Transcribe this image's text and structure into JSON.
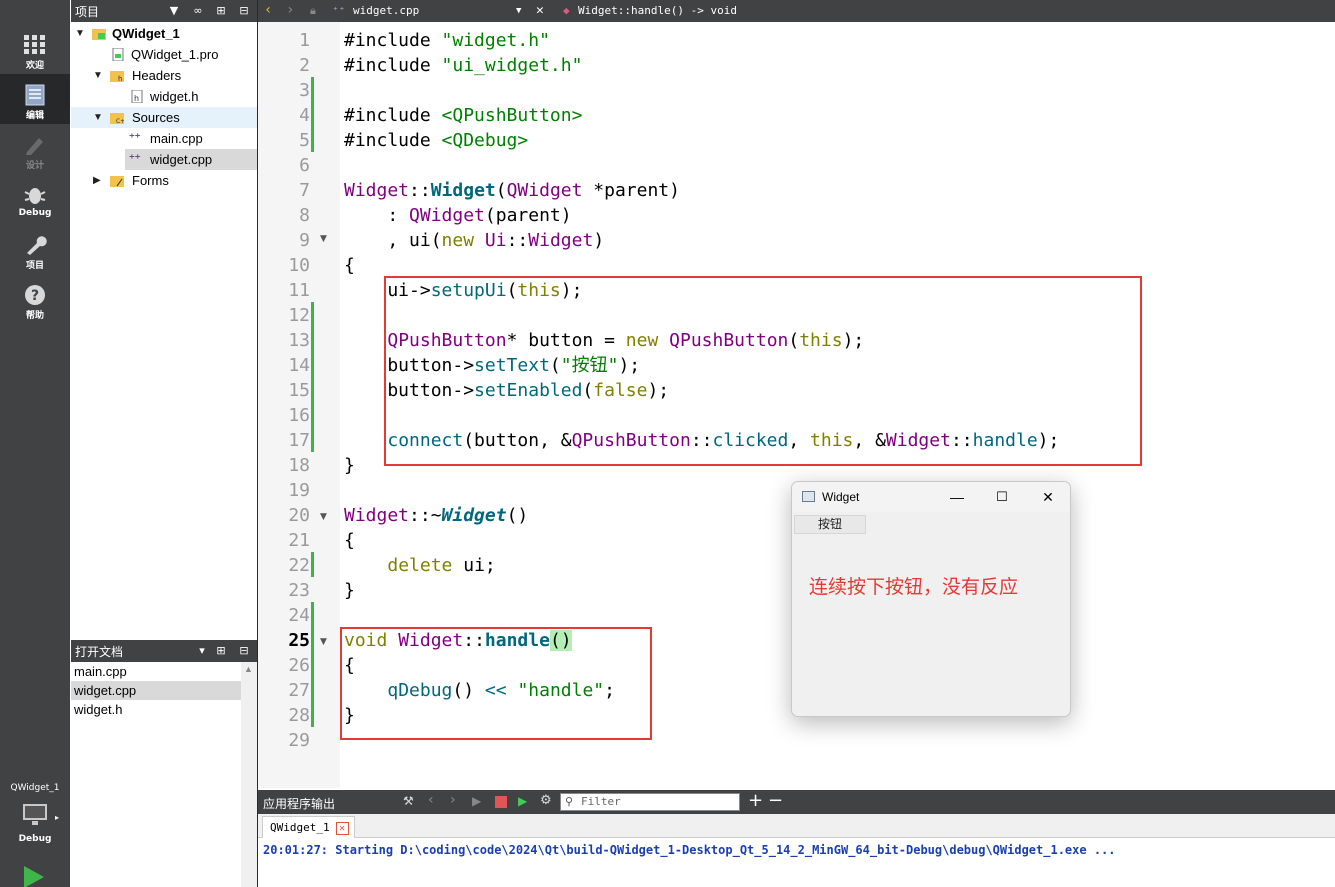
{
  "mode_bar": {
    "items": [
      {
        "label": "欢迎",
        "icon": "grid-icon"
      },
      {
        "label": "编辑",
        "icon": "edit-document-icon"
      },
      {
        "label": "设计",
        "icon": "pencil-icon"
      },
      {
        "label": "Debug",
        "icon": "bug-icon"
      },
      {
        "label": "项目",
        "icon": "wrench-icon"
      },
      {
        "label": "帮助",
        "icon": "help-icon"
      }
    ],
    "target_project": "QWidget_1",
    "target_mode": "Debug"
  },
  "project_panel": {
    "title": "项目",
    "tree": [
      {
        "label": "QWidget_1",
        "level": 0,
        "expanded": true,
        "icon": "qt-project-icon"
      },
      {
        "label": "QWidget_1.pro",
        "level": 1,
        "icon": "pro-file-icon"
      },
      {
        "label": "Headers",
        "level": 1,
        "expanded": true,
        "icon": "headers-folder-icon"
      },
      {
        "label": "widget.h",
        "level": 2,
        "icon": "header-file-icon"
      },
      {
        "label": "Sources",
        "level": 1,
        "expanded": true,
        "icon": "sources-folder-icon"
      },
      {
        "label": "main.cpp",
        "level": 2,
        "icon": "cpp-file-icon"
      },
      {
        "label": "widget.cpp",
        "level": 2,
        "icon": "cpp-file-icon",
        "selected": true
      },
      {
        "label": "Forms",
        "level": 1,
        "expanded": false,
        "icon": "forms-folder-icon"
      }
    ]
  },
  "open_docs": {
    "title": "打开文档",
    "items": [
      "main.cpp",
      "widget.cpp",
      "widget.h"
    ],
    "selected": "widget.cpp"
  },
  "editor_bar": {
    "file": "widget.cpp",
    "symbol": "Widget::handle() -> void"
  },
  "editor": {
    "current_line": 25,
    "lines": [
      "#include \"widget.h\"",
      "#include \"ui_widget.h\"",
      "",
      "#include <QPushButton>",
      "#include <QDebug>",
      "",
      "Widget::Widget(QWidget *parent)",
      "    : QWidget(parent)",
      "    , ui(new Ui::Widget)",
      "{",
      "    ui->setupUi(this);",
      "",
      "    QPushButton* button = new QPushButton(this);",
      "    button->setText(\"按钮\");",
      "    button->setEnabled(false);",
      "",
      "    connect(button, &QPushButton::clicked, this, &Widget::handle);",
      "}",
      "",
      "Widget::~Widget()",
      "{",
      "    delete ui;",
      "}",
      "",
      "void Widget::handle()",
      "{",
      "    qDebug() << \"handle\";",
      "}",
      ""
    ]
  },
  "widget_window": {
    "title": "Widget",
    "button_label": "按钮",
    "annotation": "连续按下按钮，没有反应",
    "controls": [
      "minimize-icon",
      "maximize-icon",
      "close-icon"
    ]
  },
  "output": {
    "title": "应用程序输出",
    "filter_placeholder": "Filter",
    "tab_label": "QWidget_1",
    "message": "20:01:27: Starting D:\\coding\\code\\2024\\Qt\\build-QWidget_1-Desktop_Qt_5_14_2_MinGW_64_bit-Debug\\debug\\QWidget_1.exe ..."
  },
  "colors": {
    "sidebar": "#404244",
    "highlight_box": "#e53935",
    "keyword": "#808000",
    "type": "#800080",
    "function": "#00677c",
    "string": "#008000",
    "output_text": "#1a3fb0"
  }
}
